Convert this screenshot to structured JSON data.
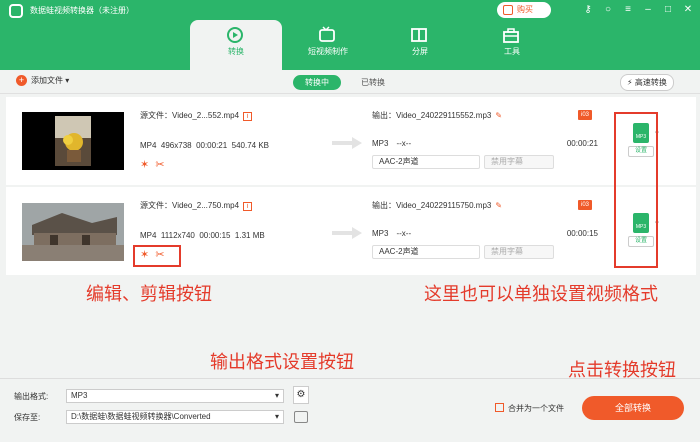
{
  "app": {
    "title": "数据蛙视频转换器（未注册）",
    "buy_label": "购买"
  },
  "window_icons": [
    "key-icon",
    "user-icon",
    "menu-icon",
    "minimize-icon",
    "restore-icon",
    "close-icon"
  ],
  "tabs": [
    {
      "label": "转换",
      "icon": "convert-icon",
      "active": true
    },
    {
      "label": "短视频制作",
      "icon": "video-maker-icon",
      "active": false
    },
    {
      "label": "分屏",
      "icon": "split-screen-icon",
      "active": false
    },
    {
      "label": "工具",
      "icon": "toolbox-icon",
      "active": false
    }
  ],
  "toolbar": {
    "add_file": "添加文件",
    "converting": "转换中",
    "converted": "已转换",
    "hispeed": "高速转换"
  },
  "files": [
    {
      "source": "源文件：Video_2...552.mp4",
      "format": "MP4",
      "resolution": "496x738",
      "duration": "00:00:21",
      "size": "540.74 KB",
      "output": "输出：Video_240229115552.mp3",
      "out_format": "MP3",
      "out_res": "--x--",
      "out_duration": "00:00:21",
      "audio": "AAC-2声道",
      "subtitle": "禁用字幕",
      "fmt_label": "MP3",
      "set_label": "设置"
    },
    {
      "source": "源文件：Video_2...750.mp4",
      "format": "MP4",
      "resolution": "1112x740",
      "duration": "00:00:15",
      "size": "1.31 MB",
      "output": "输出：Video_240229115750.mp3",
      "out_format": "MP3",
      "out_res": "--x--",
      "out_duration": "00:00:15",
      "audio": "AAC-2声道",
      "subtitle": "禁用字幕",
      "fmt_label": "MP3",
      "set_label": "设置"
    }
  ],
  "annotations": {
    "edit": "编辑、剪辑按钮",
    "format_each": "这里也可以单独设置视频格式",
    "output_format": "输出格式设置按钮",
    "convert": "点击转换按钮"
  },
  "bottom": {
    "output_format_label": "输出格式:",
    "output_format_value": "MP3",
    "save_to_label": "保存至:",
    "save_to_value": "D:\\数据蛙\\数据蛙视频转换器\\Converted",
    "merge_label": "合并为一个文件",
    "convert_all": "全部转换"
  },
  "colors": {
    "brand": "#2bb56a",
    "accent": "#f05a2a",
    "annotation": "#e43b2b"
  }
}
